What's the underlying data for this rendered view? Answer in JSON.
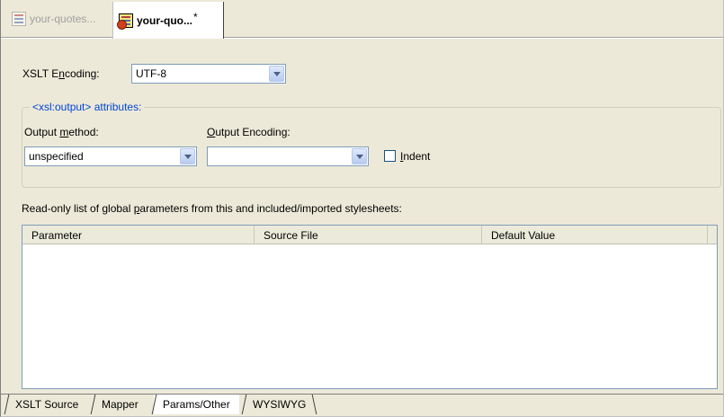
{
  "doc_tabs": [
    {
      "label": "your-quotes...",
      "icon": "xml-file-icon",
      "active": false
    },
    {
      "label": "your-quo...",
      "modified_marker": "*",
      "icon": "xml-file-icon",
      "active": true
    }
  ],
  "encoding": {
    "label_pre": "XSLT E",
    "label_accel": "n",
    "label_post": "coding:",
    "value": "UTF-8"
  },
  "output_group": {
    "caption": "<xsl:output> attributes:",
    "method": {
      "label_pre": "Output ",
      "label_accel": "m",
      "label_post": "ethod:",
      "value": "unspecified"
    },
    "encoding": {
      "label_pre": "",
      "label_accel": "O",
      "label_post": "utput Encoding:",
      "value": ""
    },
    "indent": {
      "label_pre": "",
      "label_accel": "I",
      "label_post": "ndent",
      "checked": false
    }
  },
  "params": {
    "caption_pre": "Read-only list of global ",
    "caption_accel": "p",
    "caption_post": "arameters from this and included/imported stylesheets:",
    "columns": [
      "Parameter",
      "Source File",
      "Default Value"
    ],
    "rows": []
  },
  "view_tabs": [
    {
      "label": "XSLT Source",
      "active": false
    },
    {
      "label": "Mapper",
      "active": false
    },
    {
      "label": "Params/Other",
      "active": true
    },
    {
      "label": "WYSIWYG",
      "active": false
    }
  ],
  "colors": {
    "panel_bg": "#ece9d8",
    "group_caption": "#0046d5",
    "field_border": "#7f9db9"
  }
}
